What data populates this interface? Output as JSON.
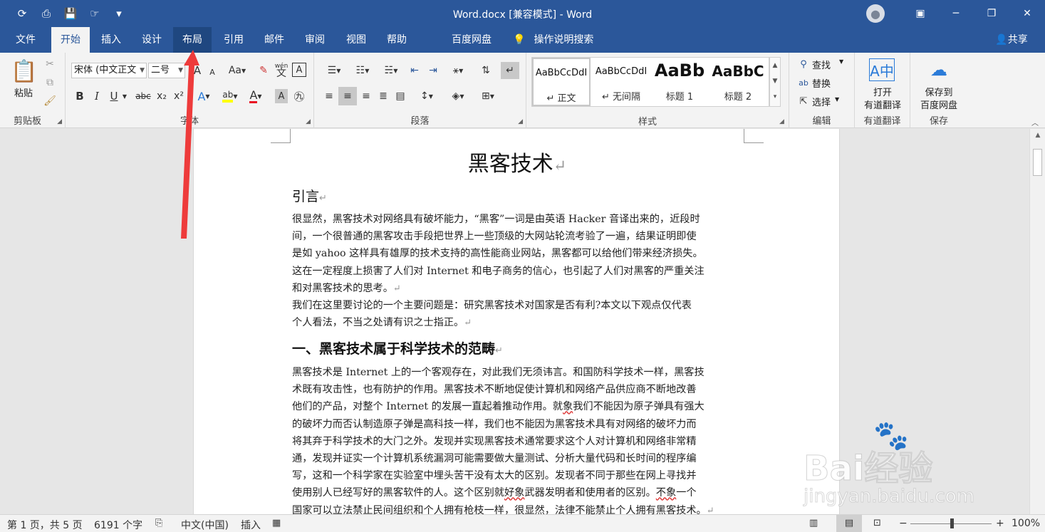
{
  "window": {
    "title": "Word.docx [兼容模式]  -  Word",
    "minimize_glyph": "─",
    "restore_glyph": "❐",
    "close_glyph": "✕"
  },
  "tabs": [
    {
      "label": "文件",
      "state": "normal"
    },
    {
      "label": "开始",
      "state": "active"
    },
    {
      "label": "插入",
      "state": "normal"
    },
    {
      "label": "设计",
      "state": "normal"
    },
    {
      "label": "布局",
      "state": "hover"
    },
    {
      "label": "引用",
      "state": "normal"
    },
    {
      "label": "邮件",
      "state": "normal"
    },
    {
      "label": "审阅",
      "state": "normal"
    },
    {
      "label": "视图",
      "state": "normal"
    },
    {
      "label": "帮助",
      "state": "normal"
    },
    {
      "label": "百度网盘",
      "state": "normal"
    }
  ],
  "tell_me": "操作说明搜索",
  "share": "共享",
  "ribbon": {
    "clipboard": {
      "paste": "粘贴",
      "label": "剪贴板"
    },
    "font": {
      "font_name": "宋体 (中文正文",
      "font_size": "二号",
      "label": "字体",
      "bold": "B",
      "italic": "I",
      "underline": "U",
      "strike": "abc",
      "subscript": "x₂",
      "superscript": "x²",
      "change_case": "Aa",
      "grow": "A",
      "shrink": "A",
      "phonetic": "wén",
      "phonetic_char": "文"
    },
    "paragraph": {
      "label": "段落"
    },
    "styles": {
      "label": "样式",
      "items": [
        {
          "sample": "AaBbCcDdI",
          "name": "↵ 正文"
        },
        {
          "sample": "AaBbCcDdI",
          "name": "↵ 无间隔"
        },
        {
          "sample": "AaBb",
          "name": "标题 1"
        },
        {
          "sample": "AaBbC",
          "name": "标题 2"
        }
      ]
    },
    "editing": {
      "find": "查找",
      "replace": "替换",
      "select": "选择",
      "label": "编辑"
    },
    "youdao": {
      "line1": "打开",
      "line2": "有道翻译",
      "label": "有道翻译"
    },
    "baidu": {
      "line1": "保存到",
      "line2": "百度网盘",
      "label": "保存"
    }
  },
  "document": {
    "title": "黑客技术",
    "h_intro": "引言",
    "p1": [
      "很显然，黑客技术对网络具有破坏能力，“黑客”一词是由英语 Hacker 音译出来的，近段时",
      "间，一个很普通的黑客攻击手段把世界上一些顶级的大网站轮流考验了一遍，结果证明即使",
      "是如 yahoo 这样具有雄厚的技术支持的高性能商业网站，黑客都可以给他们带来经济损失。",
      "这在一定程度上损害了人们对 Internet 和电子商务的信心，也引起了人们对黑客的严重关注",
      "和对黑客技术的思考。"
    ],
    "p2": [
      "我们在这里要讨论的一个主要问题是：研究黑客技术对国家是否有利?本文以下观点仅代表",
      "个人看法，不当之处请有识之士指正。"
    ],
    "h_section1": "一、黑客技术属于科学技术的范畴",
    "p3": [
      "黑客技术是 Internet 上的一个客观存在，对此我们无须讳言。和国防科学技术一样，黑客技",
      "术既有攻击性，也有防护的作用。黑客技术不断地促使计算机和网络产品供应商不断地改善",
      "他们的产品，对整个 Internet 的发展一直起着推动作用。",
      "的破坏力而否认制造原子弹是高科技一样，我们也不能因为黑客技术具有对网络的破坏力而",
      "将其弃于科学技术的大门之外。发现并实现黑客技术通常要求这个人对计算机和网络非常精",
      "通，发现并证实一个计算机系统漏洞可能需要做大量测试、分析大量代码和长时间的程序编",
      "写，这和一个科学家在实验室中埋头苦干没有太大的区别。发现者不同于那些在网上寻找并",
      "使用别人已经写好的黑客软件的人。这个区别就",
      "国家可以立法禁止民间组织和个人拥有枪枝一样，很显然，法律不能禁止个人拥有黑客技术。"
    ],
    "p3_line3_a": "就",
    "p3_line3_wavy": "象",
    "p3_line3_b": "我们不能因为原子弹具有强大",
    "p3_line8_wavy1": "好象",
    "p3_line8_mid": "武器发明者和使用者的区别。",
    "p3_line8_wavy2": "不象",
    "p3_line8_end": "一个",
    "para_mark": "↵"
  },
  "status": {
    "page": "第 1 页，共 5 页",
    "words": "6191 个字",
    "language": "中文(中国)",
    "mode": "插入",
    "zoom": "100%",
    "zoom_percent": 100,
    "minus": "−",
    "plus": "+"
  },
  "watermark": {
    "brand": "Bai经验",
    "url": "jingyan.baidu.com"
  },
  "colors": {
    "accent": "#2b579a",
    "arrow": "#ee3b3b",
    "highlight": "#ffff00",
    "font_color": "#e81123"
  }
}
